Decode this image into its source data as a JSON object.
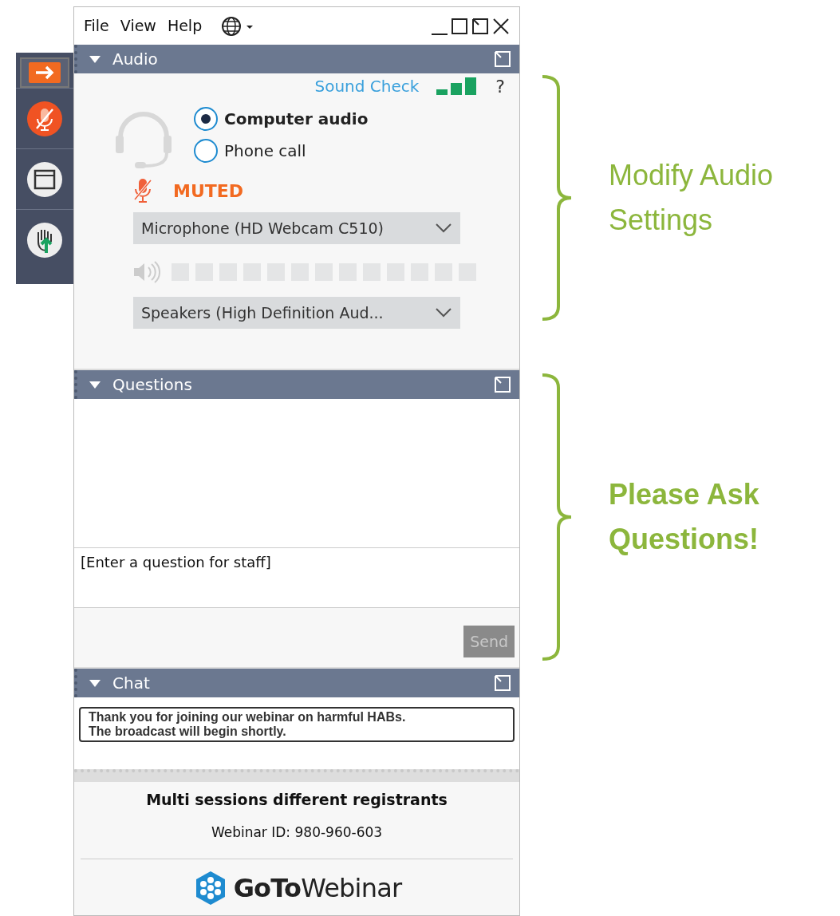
{
  "menu": [
    "File",
    "View",
    "Help"
  ],
  "panels": [
    {
      "kind": "audio",
      "title": "Audio",
      "expanded": true
    },
    {
      "kind": "questions",
      "title": "Questions",
      "expanded": true
    },
    {
      "kind": "chat",
      "title": "Chat",
      "expanded": true
    }
  ],
  "audio": {
    "sound_check": "Sound Check",
    "help": "?",
    "options": [
      {
        "label": "Computer audio",
        "selected": true
      },
      {
        "label": "Phone call",
        "selected": false
      }
    ],
    "mic_status": "MUTED",
    "microphone": "Microphone (HD Webcam C510)",
    "speakers": "Speakers (High Definition Aud..."
  },
  "questions": {
    "placeholder": "[Enter a question for staff]",
    "send": {
      "label": "Send",
      "disabled": true
    }
  },
  "chat": {
    "messages": [
      "Thank you for joining our webinar on harmful HABs.\nThe broadcast will begin shortly."
    ]
  },
  "footer": {
    "title": "Multi sessions different registrants",
    "webinar_id": "Webinar ID: 980-960-603",
    "logo": "**GoTo**Webinar"
  },
  "annotations": [
    {
      "text": "Modify Audio Settings",
      "bold": false
    },
    {
      "text": "Please Ask Questions!",
      "bold": true
    }
  ]
}
